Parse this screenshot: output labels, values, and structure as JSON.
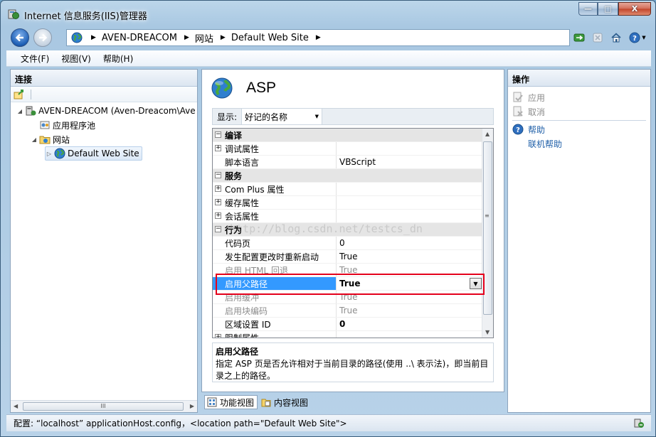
{
  "window": {
    "title": "Internet 信息服务(IIS)管理器",
    "buttons": {
      "minimize": "—",
      "maximize": "□",
      "close": "X"
    }
  },
  "address": {
    "crumbs": [
      "AVEN-DREACOM",
      "网站",
      "Default Web Site"
    ]
  },
  "menu": [
    "文件(F)",
    "视图(V)",
    "帮助(H)"
  ],
  "connections": {
    "header": "连接",
    "tree": [
      {
        "label": "AVEN-DREACOM (Aven-Dreacom\\Ave",
        "icon": "server-icon"
      },
      {
        "label": "应用程序池",
        "icon": "app-pool-icon"
      },
      {
        "label": "网站",
        "icon": "sites-folder-icon"
      },
      {
        "label": "Default Web Site",
        "icon": "globe-icon"
      }
    ],
    "scroll_grip": "III"
  },
  "main": {
    "title": "ASP",
    "show_label": "显示:",
    "show_value": "好记的名称",
    "rows": [
      {
        "type": "cat",
        "box": "⊟",
        "label": "编译"
      },
      {
        "type": "item",
        "box": "⊞",
        "label": "调试属性",
        "value": ""
      },
      {
        "type": "item",
        "box": "",
        "label": "脚本语言",
        "value": "VBScript"
      },
      {
        "type": "cat",
        "box": "⊟",
        "label": "服务"
      },
      {
        "type": "item",
        "box": "⊞",
        "label": "Com Plus 属性",
        "value": ""
      },
      {
        "type": "item",
        "box": "⊞",
        "label": "缓存属性",
        "value": ""
      },
      {
        "type": "item",
        "box": "⊞",
        "label": "会话属性",
        "value": ""
      },
      {
        "type": "cat",
        "box": "⊟",
        "label": "行为"
      },
      {
        "type": "item",
        "box": "",
        "label": "代码页",
        "value": "0"
      },
      {
        "type": "item",
        "box": "",
        "label": "发生配置更改时重新启动",
        "value": "True"
      },
      {
        "type": "dis",
        "box": "",
        "label": "启用 HTML 回退",
        "value": "True"
      },
      {
        "type": "sel",
        "box": "",
        "label": "启用父路径",
        "value": "True"
      },
      {
        "type": "dis",
        "box": "",
        "label": "启用缓冲",
        "value": "True"
      },
      {
        "type": "dis",
        "box": "",
        "label": "启用块编码",
        "value": "True"
      },
      {
        "type": "bold",
        "box": "",
        "label": "区域设置 ID",
        "value": "0"
      },
      {
        "type": "item",
        "box": "⊞",
        "label": "限制属性",
        "value": ""
      }
    ],
    "watermark": "http://blog.csdn.net/testcs_dn",
    "description_title": "启用父路径",
    "description_text": "指定 ASP 页是否允许相对于当前目录的路径(使用 ..\\ 表示法)，即当前目录之上的路径。",
    "tabs": [
      "功能视图",
      "内容视图"
    ]
  },
  "actions": {
    "header": "操作",
    "items": [
      {
        "label": "应用",
        "icon": "apply-icon"
      },
      {
        "label": "取消",
        "icon": "cancel-icon"
      },
      {
        "label": "帮助",
        "icon": "help-icon"
      },
      {
        "label": "联机帮助",
        "icon": ""
      }
    ]
  },
  "status": {
    "text": "配置: “localhost” applicationHost.config，<location path=\"Default Web Site\">"
  },
  "colors": {
    "selection": "#3399ff",
    "highlight_box": "#e4001b",
    "link": "#1f5fa8"
  }
}
